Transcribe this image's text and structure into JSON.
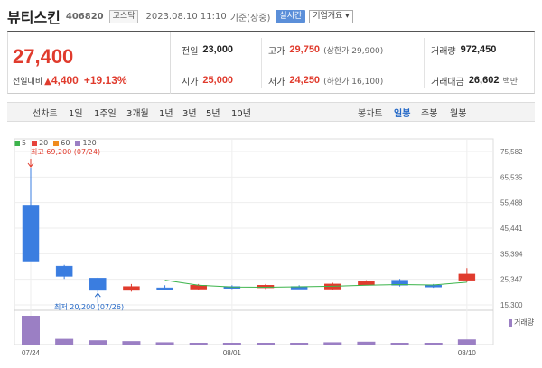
{
  "header": {
    "name": "뷰티스킨",
    "code": "406820",
    "market": "코스닥",
    "datetime": "2023.08.10 11:10",
    "basis": "기준(장중)",
    "realtime": "실시간",
    "company_info": "기업개요 ▾"
  },
  "quote": {
    "price": "27,400",
    "change_label": "전일대비",
    "change_arrow": "▲",
    "change_value": "4,400",
    "change_pct": "+19.13%",
    "prev_close_label": "전일",
    "prev_close": "23,000",
    "high_label": "고가",
    "high": "29,750",
    "upper_limit": "(상한가 29,900)",
    "volume_label": "거래량",
    "volume": "972,450",
    "open_label": "시가",
    "open": "25,000",
    "low_label": "저가",
    "low": "24,250",
    "lower_limit": "(하한가 16,100)",
    "amount_label": "거래대금",
    "amount": "26,602",
    "amount_unit": "백만"
  },
  "tabs": {
    "line_title": "선차트",
    "periods": [
      "1일",
      "1주일",
      "3개월",
      "1년",
      "3년",
      "5년",
      "10년"
    ],
    "candle_title": "봉차트",
    "candle_periods": [
      "일봉",
      "주봉",
      "월봉"
    ],
    "active_candle": "일봉"
  },
  "legend": [
    {
      "label": "5",
      "color": "#3cb44b"
    },
    {
      "label": "20",
      "color": "#e6413a"
    },
    {
      "label": "60",
      "color": "#f08c1e"
    },
    {
      "label": "120",
      "color": "#9b7fc4"
    }
  ],
  "annotations": {
    "high": "최고 69,200 (07/24)",
    "low": "최저 20,200 (07/26)"
  },
  "volume_label": "거래량",
  "colors": {
    "up": "#e03b2d",
    "down": "#3a7de0",
    "ma5": "#3cb44b",
    "volume": "#9b7fc4"
  },
  "chart_data": {
    "type": "candlestick",
    "y_ticks": [
      75582,
      65535,
      55488,
      45441,
      35394,
      25347,
      15300
    ],
    "ylim": [
      15300,
      75582
    ],
    "x_labels": [
      "07/24",
      "08/01",
      "08/10"
    ],
    "x_label_index": [
      0,
      6,
      13
    ],
    "candles": [
      {
        "open": 54500,
        "close": 32500,
        "high": 69200,
        "low": 32500
      },
      {
        "open": 30500,
        "close": 26500,
        "high": 31000,
        "low": 25500
      },
      {
        "open": 25800,
        "close": 21000,
        "high": 26000,
        "low": 20200
      },
      {
        "open": 21000,
        "close": 22500,
        "high": 23500,
        "low": 20500
      },
      {
        "open": 22000,
        "close": 21500,
        "high": 23000,
        "low": 21000
      },
      {
        "open": 21500,
        "close": 23000,
        "high": 23500,
        "low": 21000
      },
      {
        "open": 22500,
        "close": 22000,
        "high": 23000,
        "low": 21500
      },
      {
        "open": 22000,
        "close": 23000,
        "high": 23500,
        "low": 21500
      },
      {
        "open": 22500,
        "close": 21500,
        "high": 23000,
        "low": 21500
      },
      {
        "open": 21500,
        "close": 23500,
        "high": 24000,
        "low": 21000
      },
      {
        "open": 23000,
        "close": 24500,
        "high": 25000,
        "low": 23000
      },
      {
        "open": 25000,
        "close": 23000,
        "high": 25500,
        "low": 22500
      },
      {
        "open": 23000,
        "close": 22500,
        "high": 23500,
        "low": 22000
      },
      {
        "open": 25000,
        "close": 27400,
        "high": 29750,
        "low": 24250
      }
    ],
    "ma5": [
      null,
      null,
      null,
      null,
      25000,
      23000,
      22300,
      22200,
      22400,
      22600,
      23000,
      23300,
      23100,
      24200
    ],
    "volume": [
      100,
      20,
      15,
      12,
      8,
      6,
      5,
      5,
      5,
      8,
      10,
      6,
      5,
      18
    ]
  }
}
